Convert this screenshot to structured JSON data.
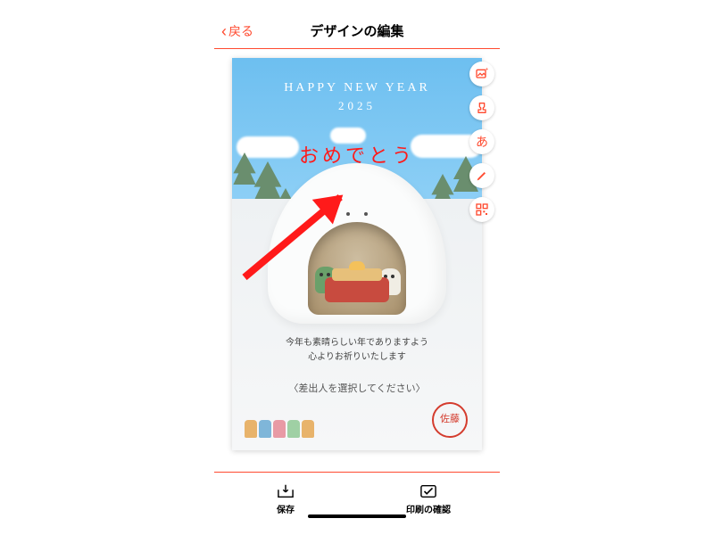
{
  "header": {
    "back_label": "戻る",
    "title": "デザインの編集"
  },
  "card": {
    "greeting": "HAPPY NEW YEAR",
    "year": "2025",
    "overlay_text": "おめでとう",
    "message_line1": "今年も素晴らしい年でありますよう",
    "message_line2": "心よりお祈りいたします",
    "sender_placeholder": "〈差出人を選択してください〉",
    "hanko_text": "佐藤"
  },
  "tools": {
    "add_image": "image-add-icon",
    "stamp": "stamp-icon",
    "text": "あ",
    "pen": "pen-icon",
    "qr": "qr-icon"
  },
  "tabs": {
    "save": "保存",
    "print": "印刷の確認"
  },
  "colors": {
    "accent": "#ff4a2f",
    "overlay_red": "#ff1a1a"
  }
}
